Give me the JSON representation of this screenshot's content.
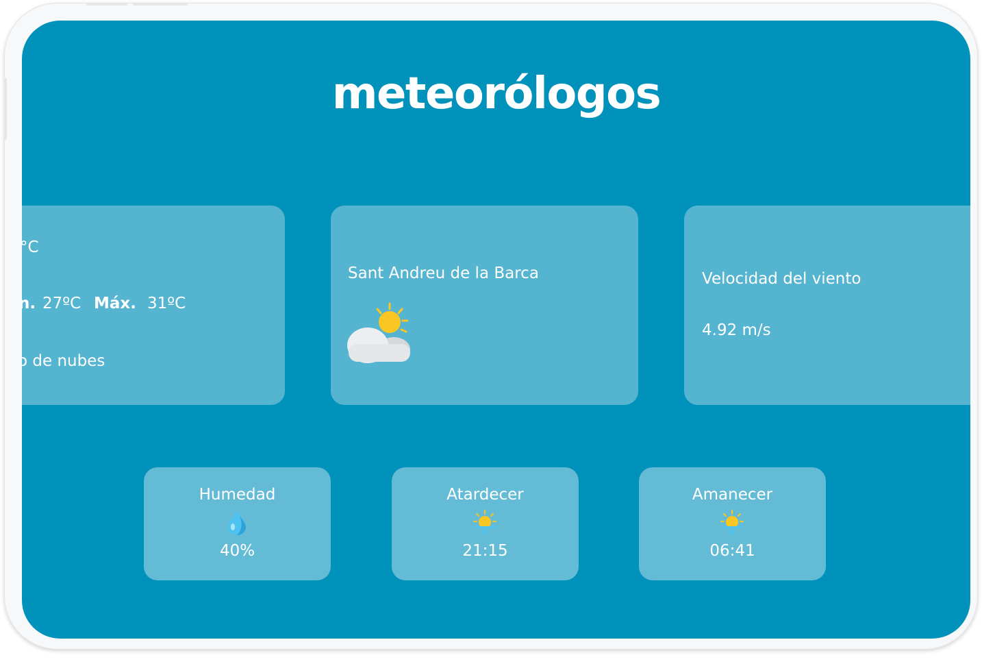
{
  "app": {
    "title": "meteorólogos"
  },
  "summary": {
    "temp_fragment": "°C",
    "min_label_fragment": "n.",
    "min_value": "27ºC",
    "max_label": "Máx.",
    "max_value": "31ºC",
    "description_fragment": "o de nubes"
  },
  "location": {
    "city": "Sant Andreu de la Barca",
    "icon": "partly-cloudy-icon"
  },
  "wind": {
    "label": "Velocidad del viento",
    "value": "4.92 m/s"
  },
  "stats": [
    {
      "label": "Humedad",
      "value": "40%",
      "icon": "water-drop-icon"
    },
    {
      "label": "Atardecer",
      "value": "21:15",
      "icon": "sunset-icon"
    },
    {
      "label": "Amanecer",
      "value": "06:41",
      "icon": "sunrise-icon"
    }
  ],
  "colors": {
    "background": "#0192bb",
    "card": "#55b4d0",
    "stat_card": "#64bbd6",
    "sun": "#f9c623",
    "drop": "#4fc3ef"
  }
}
